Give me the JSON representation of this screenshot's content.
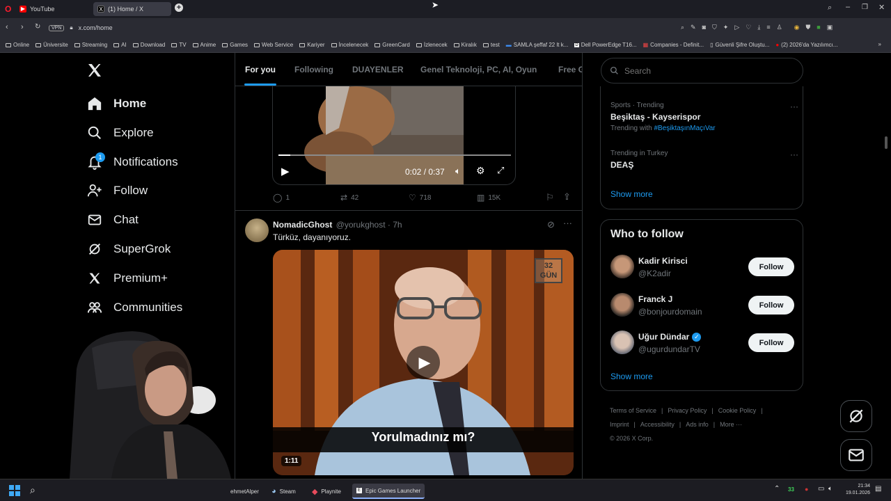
{
  "browser": {
    "tabs": [
      {
        "title": "YouTube"
      },
      {
        "title": "(1) Home / X"
      }
    ],
    "url": "x.com/home",
    "vpn_label": "VPN",
    "bookmarks": [
      "Online",
      "Üniversite",
      "Streaming",
      "AI",
      "Download",
      "TV",
      "Anime",
      "Games",
      "Web Service",
      "Kariyer",
      "İncelenecek",
      "GreenCard",
      "İzlenecek",
      "Kiralık",
      "test",
      "SAMLA şeffaf 22 lt k...",
      "Dell PowerEdge T16...",
      "Companies - Definit...",
      "Güvenli Şifre Oluştu...",
      "(2) 2026'da Yazılımcı..."
    ]
  },
  "sidebar": {
    "items": [
      {
        "label": "Home",
        "icon": "home-icon"
      },
      {
        "label": "Explore",
        "icon": "search-icon"
      },
      {
        "label": "Notifications",
        "icon": "bell-icon",
        "badge": "1"
      },
      {
        "label": "Follow",
        "icon": "add-person-icon"
      },
      {
        "label": "Chat",
        "icon": "mail-icon"
      },
      {
        "label": "SuperGrok",
        "icon": "grok-icon"
      },
      {
        "label": "Premium+",
        "icon": "x-logo-icon"
      },
      {
        "label": "Communities",
        "icon": "people-icon"
      }
    ]
  },
  "feed": {
    "tabs": [
      "For you",
      "Following",
      "DUAYENLER",
      "Genel Teknoloji, PC, AI, Oyun",
      "Free G"
    ],
    "video1": {
      "time": "0:02 / 0:37",
      "progress": 0.05
    },
    "post1_actions": {
      "replies": "1",
      "reposts": "42",
      "likes": "718",
      "views": "15K"
    },
    "post2": {
      "author": "NomadicGhost",
      "handle": "@yorukghost",
      "time": "· 7h",
      "text": "Türküz, dayanıyoruz.",
      "video_caption": "Yorulmadınız mı?",
      "video_watermark": "32 GÜN",
      "duration": "1:11"
    }
  },
  "search": {
    "placeholder": "Search"
  },
  "trends": [
    {
      "context": "Sports · Trending",
      "title": "Beşiktaş - Kayserispor",
      "sub_prefix": "Trending with",
      "sub_tag": "#BeşiktaşınMaçıVar"
    },
    {
      "context": "Trending in Turkey",
      "title": "DEAŞ"
    }
  ],
  "trends_show_more": "Show more",
  "who_to_follow": {
    "title": "Who to follow",
    "users": [
      {
        "name": "Kadir Kirisci",
        "handle": "@K2adir",
        "button": "Follow",
        "verified": false
      },
      {
        "name": "Franck J",
        "handle": "@bonjourdomain",
        "button": "Follow",
        "verified": false
      },
      {
        "name": "Uğur Dündar",
        "handle": "@ugurdundarTV",
        "button": "Follow",
        "verified": true
      }
    ],
    "show_more": "Show more"
  },
  "footer": {
    "row1": [
      "Terms of Service",
      "|",
      "Privacy Policy",
      "|",
      "Cookie Policy",
      "|"
    ],
    "row2": [
      "Imprint",
      "|",
      "Accessibility",
      "|",
      "Ads info",
      "|",
      "More ···"
    ],
    "copyright": "© 2026 X Corp."
  },
  "taskbar": {
    "apps": [
      "ehmetAlper",
      "Steam",
      "Playnite",
      "Epic Games Launcher"
    ],
    "tray_count": "33",
    "time": "21:34",
    "date": "19.01.2026"
  },
  "colors": {
    "accent": "#1d9bf0",
    "background": "#000000",
    "text": "#e7e9ea",
    "muted": "#71767b"
  }
}
